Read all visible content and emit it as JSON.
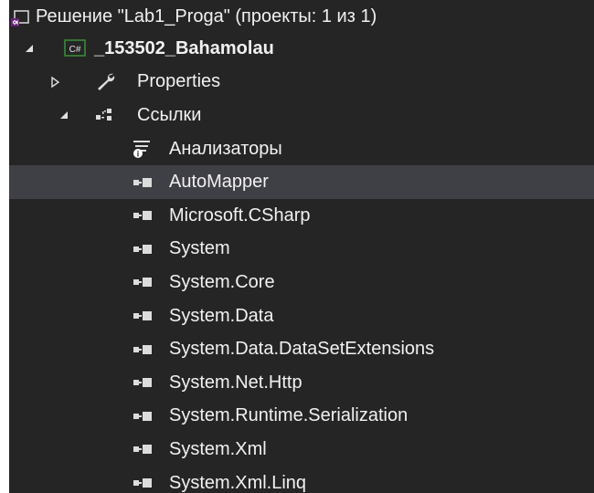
{
  "tree": {
    "solution": {
      "label": "Решение \"Lab1_Proga\" (проекты: 1 из 1)",
      "icon": "solution-icon"
    },
    "project": {
      "label": "_153502_Bahamolau",
      "icon": "csharp-project-icon",
      "icon_text": "C#",
      "expanded": true
    },
    "properties": {
      "label": "Properties",
      "icon": "wrench-icon",
      "expanded": false
    },
    "references": {
      "label": "Ссылки",
      "icon": "references-icon",
      "expanded": true,
      "analyzers": {
        "label": "Анализаторы",
        "icon": "analyzer-icon"
      },
      "items": [
        {
          "label": "AutoMapper",
          "selected": true
        },
        {
          "label": "Microsoft.CSharp",
          "selected": false
        },
        {
          "label": "System",
          "selected": false
        },
        {
          "label": "System.Core",
          "selected": false
        },
        {
          "label": "System.Data",
          "selected": false
        },
        {
          "label": "System.Data.DataSetExtensions",
          "selected": false
        },
        {
          "label": "System.Net.Http",
          "selected": false
        },
        {
          "label": "System.Runtime.Serialization",
          "selected": false
        },
        {
          "label": "System.Xml",
          "selected": false
        },
        {
          "label": "System.Xml.Linq",
          "selected": false
        }
      ]
    }
  },
  "colors": {
    "background": "#252526",
    "text": "#f1f1f1",
    "selected_row": "#3f3f46",
    "solution_icon": "#68217a",
    "project_icon_border": "#388a34",
    "wrench": "#dcdcdc",
    "reference_icon": "#dcdcdc"
  }
}
